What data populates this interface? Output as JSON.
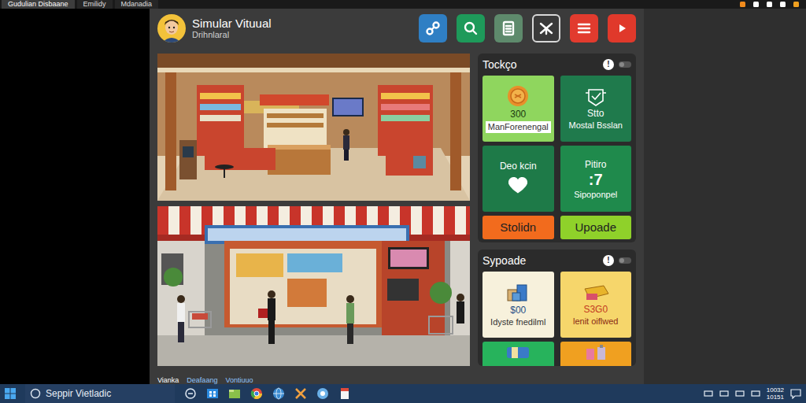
{
  "browser_tabs": [
    {
      "label": "Gudulian Disbaane",
      "selected": true
    },
    {
      "label": "Emilidy",
      "selected": false
    },
    {
      "label": "Mdanadia",
      "selected": false
    }
  ],
  "header": {
    "title": "Simular Vituual",
    "subtitle": "Drihnlaral"
  },
  "toolbar": [
    {
      "color": "#2f7fc4"
    },
    {
      "color": "#1e9a5a"
    },
    {
      "color": "#5e8a6c"
    },
    {
      "color": "#3a3a3a"
    },
    {
      "color": "#e23b2e"
    },
    {
      "color": "#e0392b"
    }
  ],
  "scene_tabs": [
    {
      "label": "Vianka",
      "selected": true
    },
    {
      "label": "Deafaang",
      "selected": false
    },
    {
      "label": "Vontiuuo",
      "selected": false
    }
  ],
  "stock_panel": {
    "title": "Tockço",
    "info_icon": "!",
    "toggle_on": false,
    "cards": [
      {
        "kind": "coin",
        "value": "300",
        "label": "ManForenengal",
        "color": "#8fd65e"
      },
      {
        "kind": "badge",
        "title": "Stto",
        "label": "Mostal Bsslan",
        "color": "#1f7a4c"
      },
      {
        "kind": "heart",
        "title": "Deo kcin",
        "color": "#1e7a48"
      },
      {
        "kind": "stat",
        "title": "Pitiro",
        "value": ":7",
        "label": "Sipoponpel",
        "color": "#1f8a4c"
      }
    ],
    "buttons": [
      {
        "label": "Stolidn",
        "color": "#f26b1d"
      },
      {
        "label": "Upoade",
        "color": "#8fd12a"
      }
    ]
  },
  "upgrade_panel": {
    "title": "Sypoade",
    "info_icon": "!",
    "toggle_on": false,
    "items": [
      {
        "kind": "boxes",
        "price": "$00",
        "label": "Idyste fnedilml",
        "color": "#f7f1dc"
      },
      {
        "kind": "bar",
        "price": "S3G0",
        "label": "lenit oiflwed",
        "color": "#f6d66b"
      },
      {
        "kind": "can",
        "color": "#27b35c"
      },
      {
        "kind": "bottle",
        "color": "#f0a020"
      }
    ]
  },
  "taskbar": {
    "search": "Seppir Vietladic",
    "time": "10032",
    "date": "10151"
  }
}
